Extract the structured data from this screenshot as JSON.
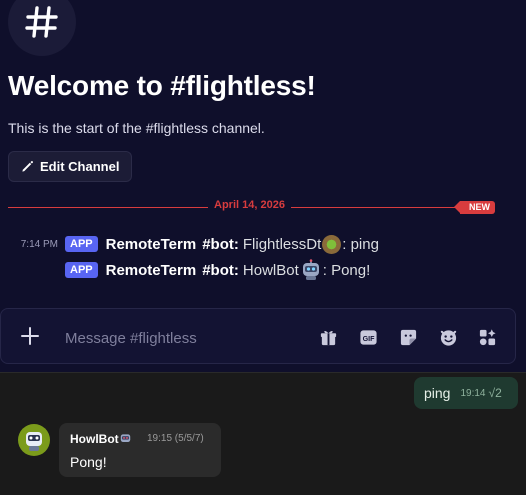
{
  "channel": {
    "welcome_title": "Welcome to #flightless!",
    "subtitle": "This is the start of the #flightless channel.",
    "edit_button": "Edit Channel"
  },
  "divider": {
    "date": "April 14, 2026",
    "badge": "NEW"
  },
  "messages": [
    {
      "time": "7:14 PM",
      "tag": "APP",
      "author": "RemoteTerm",
      "bot_label": "#bot:",
      "sender": "FlightlessDt",
      "text": ": ping"
    },
    {
      "tag": "APP",
      "author": "RemoteTerm",
      "bot_label": "#bot:",
      "sender": "HowlBot",
      "text": ": Pong!"
    }
  ],
  "composer": {
    "placeholder": "Message #flightless",
    "gif_label": "GIF"
  },
  "telegram": {
    "outgoing": {
      "text": "ping",
      "time": "19:14",
      "check": "√2"
    },
    "incoming": {
      "name": "HowlBot",
      "meta": "19:15 (5/5/7)",
      "text": "Pong!"
    }
  },
  "colors": {
    "accent": "#5865f2",
    "divider_red": "#d83c3e",
    "out_bubble": "#1f3a30"
  },
  "icons": [
    "hash-icon",
    "pencil-icon",
    "plus-icon",
    "gift-icon",
    "gif-icon",
    "sticker-icon",
    "emoji-icon",
    "apps-icon",
    "robot-avatar-icon"
  ]
}
